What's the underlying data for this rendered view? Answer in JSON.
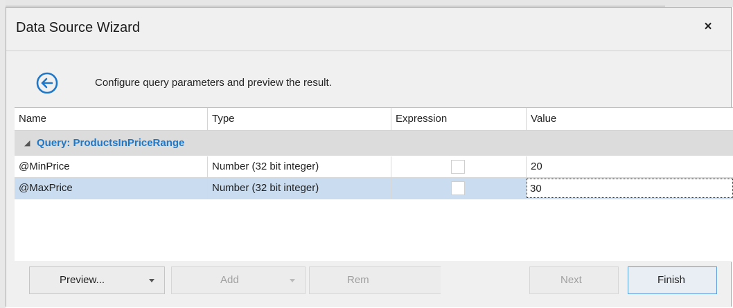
{
  "dialog": {
    "title": "Data Source Wizard",
    "close_label": "×"
  },
  "header": {
    "back_icon": "arrow-left-circle-icon",
    "text": "Configure query parameters and preview the result."
  },
  "grid": {
    "columns": [
      "Name",
      "Type",
      "Expression",
      "Value"
    ],
    "group_label": "Query: ProductsInPriceRange",
    "rows": [
      {
        "name": "@MinPrice",
        "type": "Number (32 bit integer)",
        "expression": false,
        "value": "20",
        "selected": false
      },
      {
        "name": "@MaxPrice",
        "type": "Number (32 bit integer)",
        "expression": false,
        "value": "30",
        "selected": true
      }
    ]
  },
  "buttons": {
    "preview": "Preview...",
    "add": "Add",
    "remove": "Rem",
    "next": "Next",
    "finish": "Finish"
  },
  "colors": {
    "accent": "#1e77c8",
    "selection": "#c9dcf0"
  }
}
